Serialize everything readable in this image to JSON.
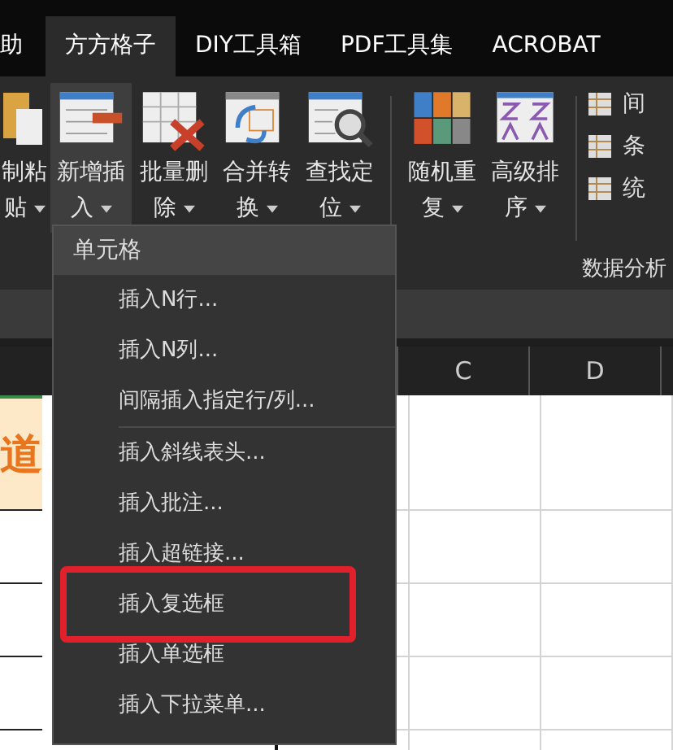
{
  "tabs": [
    {
      "label": "助",
      "selected": false
    },
    {
      "label": "方方格子",
      "selected": true
    },
    {
      "label": "DIY工具箱",
      "selected": false
    },
    {
      "label": "PDF工具集",
      "selected": false
    },
    {
      "label": "ACROBAT",
      "selected": false
    }
  ],
  "ribbon": {
    "groups": [
      {
        "buttons": [
          {
            "label_lines": [
              "制粘",
              "贴"
            ],
            "kind": "paste",
            "hovered": false
          },
          {
            "label_lines": [
              "新增插",
              "入"
            ],
            "kind": "insert",
            "hovered": true
          },
          {
            "label_lines": [
              "批量删",
              "除"
            ],
            "kind": "delete",
            "hovered": false
          },
          {
            "label_lines": [
              "合并转",
              "换"
            ],
            "kind": "merge",
            "hovered": false
          },
          {
            "label_lines": [
              "查找定",
              "位"
            ],
            "kind": "find",
            "hovered": false
          }
        ]
      },
      {
        "buttons": [
          {
            "label_lines": [
              "随机重",
              "复"
            ],
            "kind": "random",
            "hovered": false
          },
          {
            "label_lines": [
              "高级排",
              "序"
            ],
            "kind": "sort",
            "hovered": false
          }
        ]
      }
    ],
    "small_items": [
      {
        "label": "间"
      },
      {
        "label": "条"
      },
      {
        "label": "统"
      }
    ],
    "group_label": "数据分析"
  },
  "sheet": {
    "columns": [
      "C",
      "D"
    ],
    "cell_text": "道"
  },
  "menu": {
    "header": "单元格",
    "items": [
      {
        "label": "插入N行...",
        "separator_after": false,
        "highlighted": false
      },
      {
        "label": "插入N列...",
        "separator_after": false,
        "highlighted": false
      },
      {
        "label": "间隔插入指定行/列...",
        "separator_after": true,
        "highlighted": false
      },
      {
        "label": "插入斜线表头...",
        "separator_after": false,
        "highlighted": false
      },
      {
        "label": "插入批注...",
        "separator_after": false,
        "highlighted": false
      },
      {
        "label": "插入超链接...",
        "separator_after": false,
        "highlighted": false
      },
      {
        "label": "插入复选框",
        "separator_after": false,
        "highlighted": true
      },
      {
        "label": "插入单选框",
        "separator_after": false,
        "highlighted": false
      },
      {
        "label": "插入下拉菜单...",
        "separator_after": false,
        "highlighted": false
      }
    ]
  }
}
